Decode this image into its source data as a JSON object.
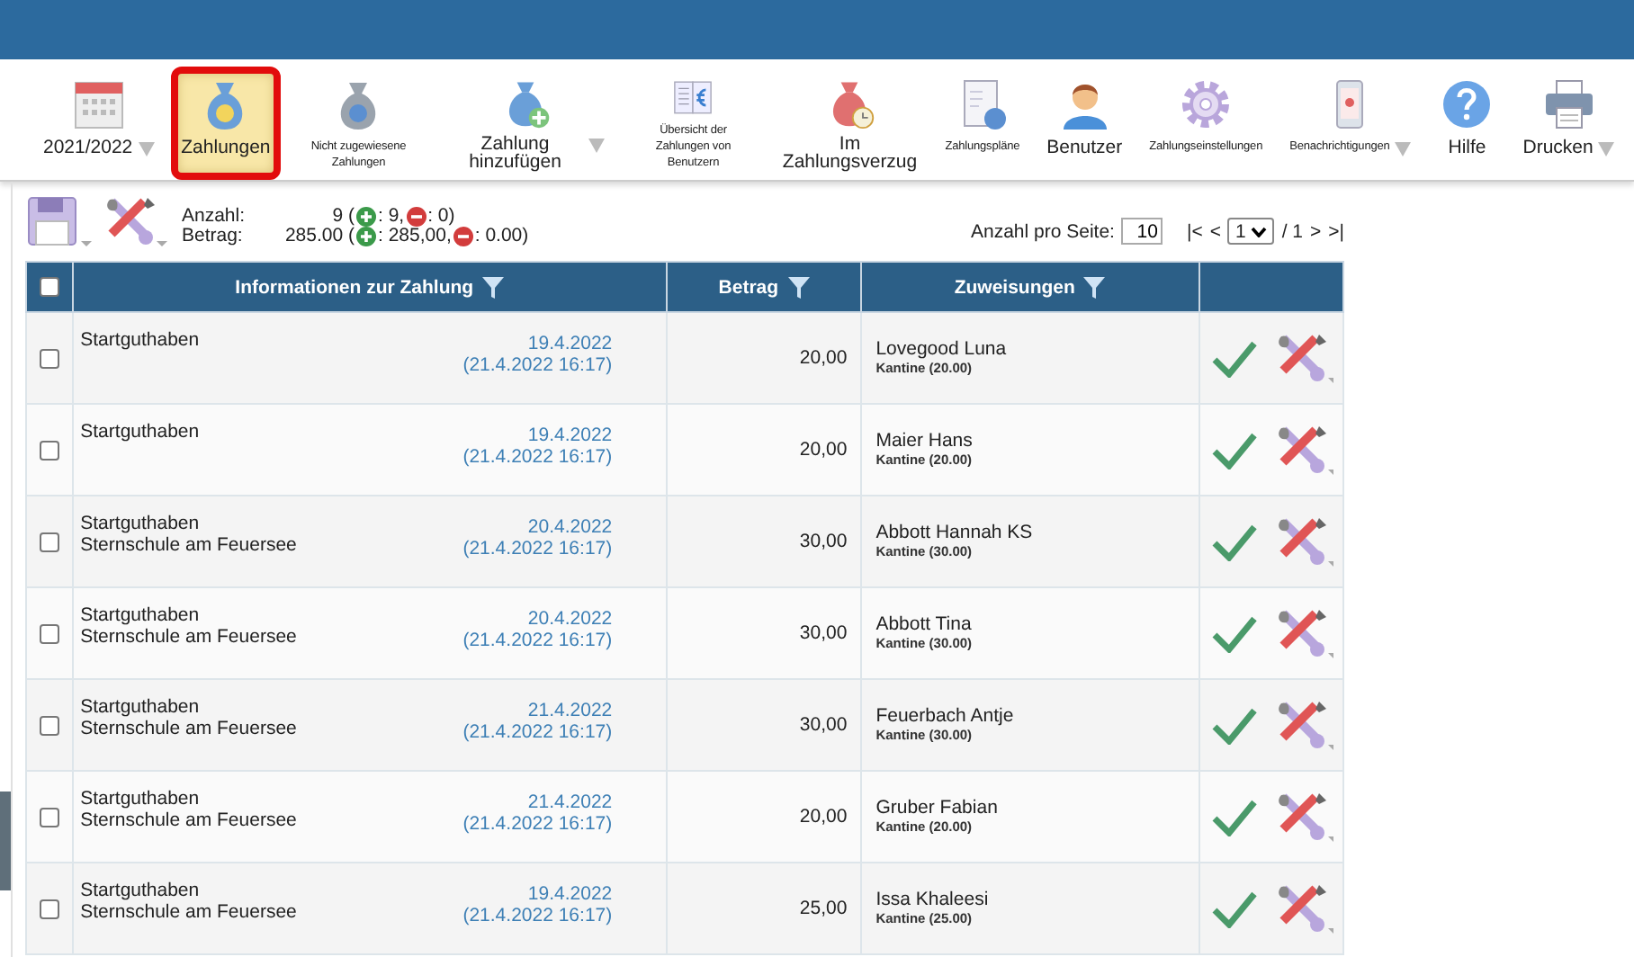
{
  "toolbar": [
    {
      "label": "2021/2022",
      "kind": "major",
      "selected": false,
      "dropdown": true
    },
    {
      "label": "Zahlungen",
      "kind": "major",
      "selected": true,
      "dropdown": false
    },
    {
      "label": "Nicht zugewiesene Zahlungen",
      "kind": "minor",
      "selected": false,
      "dropdown": false
    },
    {
      "label": "Zahlung hinzufügen",
      "kind": "major",
      "selected": false,
      "dropdown": true
    },
    {
      "label": "Übersicht der Zahlungen von Benutzern",
      "kind": "minor",
      "selected": false,
      "dropdown": false
    },
    {
      "label": "Im Zahlungsverzug",
      "kind": "major",
      "selected": false,
      "dropdown": false
    },
    {
      "label": "Zahlungspläne",
      "kind": "minor",
      "selected": false,
      "dropdown": false
    },
    {
      "label": "Benutzer",
      "kind": "major",
      "selected": false,
      "dropdown": false
    },
    {
      "label": "Zahlungseinstellungen",
      "kind": "minor",
      "selected": false,
      "dropdown": false
    },
    {
      "label": "Benachrichtigungen",
      "kind": "minor",
      "selected": false,
      "dropdown": true
    },
    {
      "label": "Hilfe",
      "kind": "major",
      "selected": false,
      "dropdown": false
    },
    {
      "label": "Drucken",
      "kind": "major",
      "selected": false,
      "dropdown": true
    }
  ],
  "summary": [
    {
      "label": "Anzahl:",
      "total": "9 (",
      "plus": ": 9,",
      "minus": ": 0)"
    },
    {
      "label": "Betrag:",
      "total": "285.00 (",
      "plus": ": 285,00,",
      "minus": ": 0.00)"
    }
  ],
  "pager": {
    "per_page_label": "Anzahl pro Seite:",
    "per_page": "10",
    "first": "|<",
    "prev": "<",
    "page": "1",
    "of": "/ 1",
    "next": ">",
    "last": ">|"
  },
  "table": {
    "select_all": {
      "checked": false
    },
    "columns": [
      "Informationen zur Zahlung",
      "Betrag",
      "Zuweisungen"
    ],
    "rows": [
      {
        "checked": false,
        "description": [
          "Startguthaben"
        ],
        "date": "19.4.2022",
        "created": "(21.4.2022 16:17)",
        "amount": "20,00",
        "user": "Lovegood Luna",
        "assignment": "Kantine (20.00)"
      },
      {
        "checked": false,
        "description": [
          "Startguthaben"
        ],
        "date": "19.4.2022",
        "created": "(21.4.2022 16:17)",
        "amount": "20,00",
        "user": "Maier Hans",
        "assignment": "Kantine (20.00)"
      },
      {
        "checked": false,
        "description": [
          "Startguthaben",
          "Sternschule am Feuersee"
        ],
        "date": "20.4.2022",
        "created": "(21.4.2022 16:17)",
        "amount": "30,00",
        "user": "Abbott Hannah KS",
        "assignment": "Kantine (30.00)"
      },
      {
        "checked": false,
        "description": [
          "Startguthaben",
          "Sternschule am Feuersee"
        ],
        "date": "20.4.2022",
        "created": "(21.4.2022 16:17)",
        "amount": "30,00",
        "user": "Abbott Tina",
        "assignment": "Kantine (30.00)"
      },
      {
        "checked": false,
        "description": [
          "Startguthaben",
          "Sternschule am Feuersee"
        ],
        "date": "21.4.2022",
        "created": "(21.4.2022 16:17)",
        "amount": "30,00",
        "user": "Feuerbach Antje",
        "assignment": "Kantine (30.00)"
      },
      {
        "checked": false,
        "description": [
          "Startguthaben",
          "Sternschule am Feuersee"
        ],
        "date": "21.4.2022",
        "created": "(21.4.2022 16:17)",
        "amount": "20,00",
        "user": "Gruber Fabian",
        "assignment": "Kantine (20.00)"
      },
      {
        "checked": false,
        "description": [
          "Startguthaben",
          "Sternschule am Feuersee"
        ],
        "date": "19.4.2022",
        "created": "(21.4.2022 16:17)",
        "amount": "25,00",
        "user": "Issa Khaleesi",
        "assignment": "Kantine (25.00)"
      }
    ]
  }
}
